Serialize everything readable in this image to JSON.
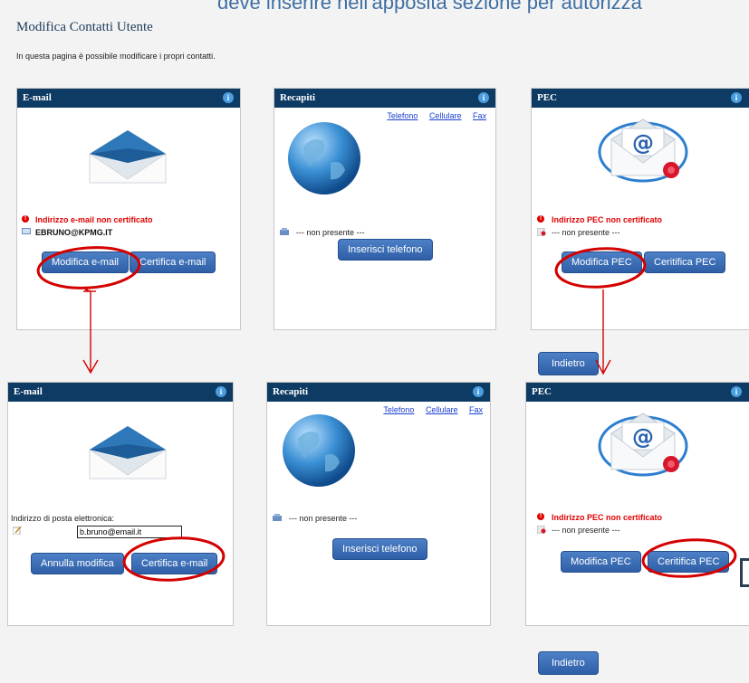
{
  "top_clip": "deve inserire nell'apposita sezione per autorizza",
  "page": {
    "title": "Modifica Contatti Utente",
    "description": "In questa pagina è possibile modificare i propri contatti."
  },
  "top": {
    "email": {
      "header": "E-mail",
      "warning": "Indirizzo e-mail non certificato",
      "address": "EBRUNO@KPMG.IT",
      "btn_modify": "Modifica e-mail",
      "btn_certify": "Certifica e-mail"
    },
    "recapiti": {
      "header": "Recapiti",
      "links": [
        "Telefono",
        "Cellulare",
        "Fax"
      ],
      "status": "--- non presente ---",
      "btn_insert": "Inserisci telefono"
    },
    "pec": {
      "header": "PEC",
      "warning": "Indirizzo PEC non certificato",
      "status": "--- non presente ---",
      "btn_modify": "Modifica PEC",
      "btn_certify": "Ceritifica PEC"
    },
    "back": "Indietro"
  },
  "bottom": {
    "email": {
      "header": "E-mail",
      "field_label": "Indirizzo di posta elettronica:",
      "field_value": "b.bruno@email.it",
      "btn_cancel": "Annulla modifica",
      "btn_certify": "Certifica e-mail"
    },
    "recapiti": {
      "header": "Recapiti",
      "links": [
        "Telefono",
        "Cellulare",
        "Fax"
      ],
      "status": "--- non presente ---",
      "btn_insert": "Inserisci telefono"
    },
    "pec": {
      "header": "PEC",
      "warning": "Indirizzo PEC non certificato",
      "status": "--- non presente ---",
      "btn_modify": "Modifica PEC",
      "btn_certify": "Ceritifica PEC"
    },
    "back": "Indietro"
  },
  "colors": {
    "header": "#0e3b63",
    "button": "#3a6cb4",
    "alert": "#e00000",
    "annotation": "#d40000"
  }
}
